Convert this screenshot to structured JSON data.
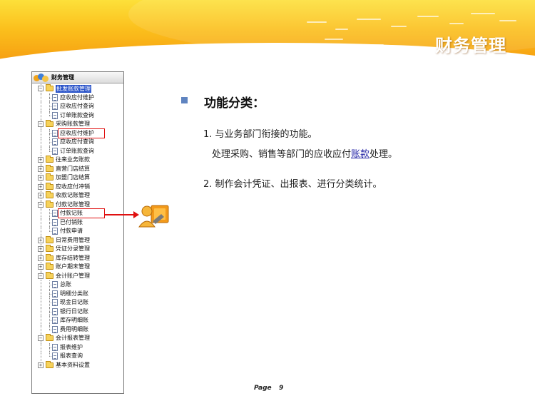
{
  "banner": {
    "title": "财务管理",
    "colors": {
      "top": "#fde03a",
      "bottom": "#f59a10"
    }
  },
  "tree": {
    "header": "财务管理",
    "nodes": [
      {
        "label": "批发账款管理",
        "level": 0,
        "type": "folder",
        "expanded": true,
        "selected": true
      },
      {
        "label": "应收应付维护",
        "level": 1,
        "type": "doc"
      },
      {
        "label": "应收应付查询",
        "level": 1,
        "type": "doc"
      },
      {
        "label": "订单账款查询",
        "level": 1,
        "type": "doc"
      },
      {
        "label": "采购账款管理",
        "level": 0,
        "type": "folder",
        "expanded": true
      },
      {
        "label": "应收应付维护",
        "level": 1,
        "type": "doc",
        "highlighted": true
      },
      {
        "label": "应收应付查询",
        "level": 1,
        "type": "doc"
      },
      {
        "label": "订单账款查询",
        "level": 1,
        "type": "doc"
      },
      {
        "label": "往来业务账款",
        "level": 0,
        "type": "folder",
        "expanded": false
      },
      {
        "label": "直营门店结算",
        "level": 0,
        "type": "folder",
        "expanded": false
      },
      {
        "label": "加盟门店结算",
        "level": 0,
        "type": "folder",
        "expanded": false
      },
      {
        "label": "应收应付冲销",
        "level": 0,
        "type": "folder",
        "expanded": false
      },
      {
        "label": "收款记账管理",
        "level": 0,
        "type": "folder",
        "expanded": false
      },
      {
        "label": "付款记账管理",
        "level": 0,
        "type": "folder",
        "expanded": true
      },
      {
        "label": "付款记账",
        "level": 1,
        "type": "doc",
        "highlighted": true
      },
      {
        "label": "已付销账",
        "level": 1,
        "type": "doc"
      },
      {
        "label": "付款申请",
        "level": 1,
        "type": "doc"
      },
      {
        "label": "日常费用管理",
        "level": 0,
        "type": "folder",
        "expanded": false
      },
      {
        "label": "凭证分录管理",
        "level": 0,
        "type": "folder",
        "expanded": false
      },
      {
        "label": "库存结转管理",
        "level": 0,
        "type": "folder",
        "expanded": false
      },
      {
        "label": "账户期末管理",
        "level": 0,
        "type": "folder",
        "expanded": false
      },
      {
        "label": "会计账户管理",
        "level": 0,
        "type": "folder",
        "expanded": true
      },
      {
        "label": "总账",
        "level": 1,
        "type": "doc"
      },
      {
        "label": "明细分类账",
        "level": 1,
        "type": "doc"
      },
      {
        "label": "现金日记账",
        "level": 1,
        "type": "doc"
      },
      {
        "label": "银行日记账",
        "level": 1,
        "type": "doc"
      },
      {
        "label": "库存明细账",
        "level": 1,
        "type": "doc"
      },
      {
        "label": "费用明细账",
        "level": 1,
        "type": "doc"
      },
      {
        "label": "会计报表管理",
        "level": 0,
        "type": "folder",
        "expanded": true
      },
      {
        "label": "报表维护",
        "level": 1,
        "type": "doc"
      },
      {
        "label": "报表查询",
        "level": 1,
        "type": "doc"
      },
      {
        "label": "基本资料设置",
        "level": 0,
        "type": "folder",
        "expanded": false
      }
    ]
  },
  "content": {
    "heading": "功能分类：",
    "item1": "1. 与业务部门衔接的功能。",
    "item1_sub_prefix": "处理采购、销售等部门的应收应付",
    "item1_sub_link": "账款",
    "item1_sub_suffix": "处理。",
    "item2": "2. 制作会计凭证、出报表、进行分类统计。"
  },
  "footer": {
    "page_label": "Page",
    "page_number": "9"
  },
  "colors": {
    "highlight": "#e01010",
    "bullet": "#5f84c0",
    "selection": "#2b54c9"
  }
}
